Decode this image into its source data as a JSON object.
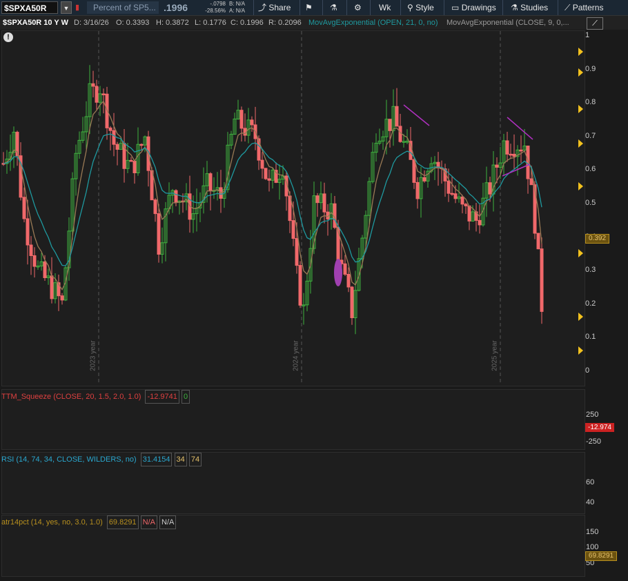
{
  "toolbar": {
    "symbol": "$SPXA50R",
    "description": "Percent of SP5...",
    "last": ".1996",
    "change": "-.0798",
    "change_pct": "-28.56%",
    "bid": "B: N/A",
    "ask": "A: N/A",
    "share": "Share",
    "period": "Wk",
    "style": "Style",
    "drawings": "Drawings",
    "studies": "Studies",
    "patterns": "Patterns"
  },
  "header": {
    "symbol_period": "$SPXA50R 10 Y W",
    "date": "D: 3/16/26",
    "open": "O: 0.3393",
    "high": "H: 0.3872",
    "low": "L: 0.1776",
    "close": "C: 0.1996",
    "range": "R: 0.2096",
    "ema1": "MovAvgExponential (OPEN, 21, 0, no)",
    "ema2": "MovAvgExponential (CLOSE, 9, 0,..."
  },
  "price_axis": {
    "ticks": [
      "1",
      "0.9",
      "0.8",
      "0.7",
      "0.6",
      "0.5",
      "0.4",
      "0.3",
      "0.2",
      "0.1",
      "0"
    ],
    "current_label": "0.392",
    "year_labels": [
      "2023 year",
      "2024 year",
      "2025 year"
    ]
  },
  "ttm": {
    "name": "TTM_Squeeze (CLOSE, 20, 1.5, 2.0, 1.0)",
    "value": "-12.9741",
    "value2": "0",
    "ticks": [
      "250",
      "-250"
    ],
    "current_label": "-12.974"
  },
  "rsi": {
    "name": "RSI (14, 74, 34, CLOSE, WILDERS, no)",
    "value": "31.4154",
    "lower": "34",
    "upper": "74",
    "ticks": [
      "60",
      "40"
    ]
  },
  "atr": {
    "name": "atr14pct (14, yes, no, 3.0, 1.0)",
    "value": "69.8291",
    "na1": "N/A",
    "na2": "N/A",
    "ticks": [
      "150",
      "100",
      "50"
    ],
    "current_label": "69.8291"
  },
  "colors": {
    "up_candle": "#3fb23f",
    "down_candle": "#f0686a",
    "ema_fast": "#9a7a55",
    "ema_slow": "#1e9aa0",
    "trendline": "#b030c0",
    "arrow": "#f2c11e",
    "rsi_line": "#9a9a9a",
    "atr_line": "#b8901e"
  }
}
